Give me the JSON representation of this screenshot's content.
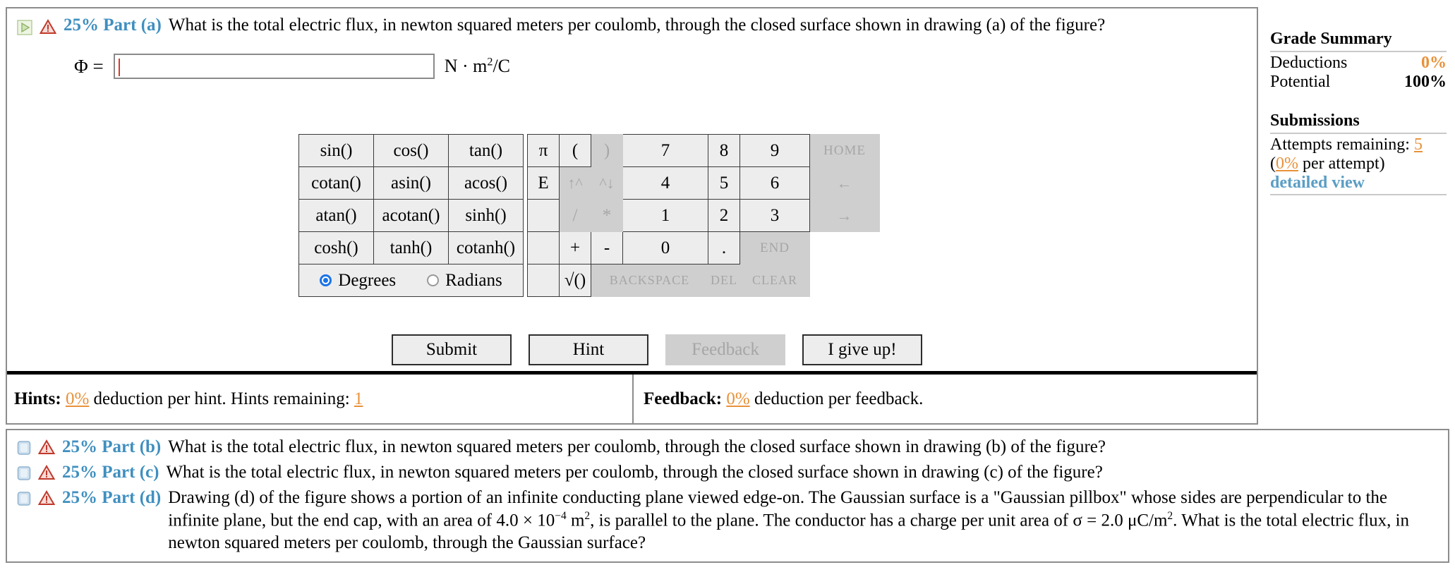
{
  "part_a": {
    "percent_label": "25% Part (a)",
    "question": "What is the total electric flux, in newton squared meters per coulomb, through the closed surface shown in drawing (a) of the figure?",
    "answer_label": "Φ =",
    "answer_value": "",
    "unit_main": "N · m",
    "unit_sup": "2",
    "unit_tail": "/C"
  },
  "calculator": {
    "trig": [
      [
        "sin()",
        "cos()",
        "tan()"
      ],
      [
        "cotan()",
        "asin()",
        "acos()"
      ],
      [
        "atan()",
        "acotan()",
        "sinh()"
      ],
      [
        "cosh()",
        "tanh()",
        "cotanh()"
      ]
    ],
    "modes": {
      "degrees_label": "Degrees",
      "radians_label": "Radians",
      "selected": "Degrees"
    },
    "keys": [
      [
        {
          "label": "π",
          "disabled": false
        },
        {
          "label": "(",
          "disabled": false
        },
        {
          "label": ")",
          "disabled": true
        },
        {
          "label": "7",
          "disabled": false
        },
        {
          "label": "8",
          "disabled": false
        },
        {
          "label": "9",
          "disabled": false
        },
        {
          "label": "HOME",
          "disabled": true
        }
      ],
      [
        {
          "label": "E",
          "disabled": false
        },
        {
          "label": "↑^",
          "disabled": true
        },
        {
          "label": "^↓",
          "disabled": true
        },
        {
          "label": "4",
          "disabled": false
        },
        {
          "label": "5",
          "disabled": false
        },
        {
          "label": "6",
          "disabled": false
        },
        {
          "label": "←",
          "disabled": true
        }
      ],
      [
        {
          "label": "",
          "disabled": false
        },
        {
          "label": "/",
          "disabled": true
        },
        {
          "label": "*",
          "disabled": true
        },
        {
          "label": "1",
          "disabled": false
        },
        {
          "label": "2",
          "disabled": false
        },
        {
          "label": "3",
          "disabled": false
        },
        {
          "label": "→",
          "disabled": true
        }
      ],
      [
        {
          "label": "",
          "disabled": false
        },
        {
          "label": "+",
          "disabled": false
        },
        {
          "label": "-",
          "disabled": false
        },
        {
          "label": "0",
          "disabled": false
        },
        {
          "label": ".",
          "disabled": false
        },
        {
          "label": "END",
          "disabled": true
        }
      ],
      [
        {
          "label": "",
          "disabled": false
        },
        {
          "label": "√()",
          "disabled": false
        },
        {
          "label": "BACKSPACE",
          "disabled": true
        },
        {
          "label": "DEL",
          "disabled": true
        },
        {
          "label": "CLEAR",
          "disabled": true
        }
      ]
    ]
  },
  "actions": {
    "submit": "Submit",
    "hint": "Hint",
    "feedback": "Feedback",
    "give_up": "I give up!"
  },
  "hints_bar": {
    "hints_label": "Hints:",
    "hints_pct": "0%",
    "hints_text": "deduction per hint. Hints remaining:",
    "hints_remaining": "1",
    "feedback_label": "Feedback:",
    "feedback_pct": "0%",
    "feedback_text": "deduction per feedback."
  },
  "sidebar": {
    "grade_title": "Grade Summary",
    "deductions_label": "Deductions",
    "deductions_value": "0%",
    "potential_label": "Potential",
    "potential_value": "100%",
    "submissions_title": "Submissions",
    "attempts_label": "Attempts remaining:",
    "attempts_value": "5",
    "per_attempt_open": "(",
    "per_attempt_pct": "0%",
    "per_attempt_text": " per attempt)",
    "detailed_view": "detailed view"
  },
  "other_parts": [
    {
      "percent_label": "25% Part (b)",
      "text": "What is the total electric flux, in newton squared meters per coulomb, through the closed surface shown in drawing (b) of the figure?"
    },
    {
      "percent_label": "25% Part (c)",
      "text": "What is the total electric flux, in newton squared meters per coulomb, through the closed surface shown in drawing (c) of the figure?"
    },
    {
      "percent_label": "25% Part (d)",
      "text_1": "Drawing (d) of the figure shows a portion of an infinite conducting plane viewed edge-on. The Gaussian surface is a \"Gaussian pillbox\" whose sides are perpendicular to the infinite plane, but the end cap, with an area of 4.0 × 10",
      "exp_1": "−4",
      "text_2": " m",
      "exp_2": "2",
      "text_3": ", is parallel to the plane. The conductor has a charge per unit area of σ = 2.0 μC/m",
      "exp_3": "2",
      "text_4": ". What is the total electric flux, in newton squared meters per coulomb, through the Gaussian surface?"
    }
  ],
  "colors": {
    "accent_blue": "#3f8fbf",
    "orange": "#e8913a",
    "link": "#5a9ec4",
    "radio_selected": "#1a73e8"
  }
}
